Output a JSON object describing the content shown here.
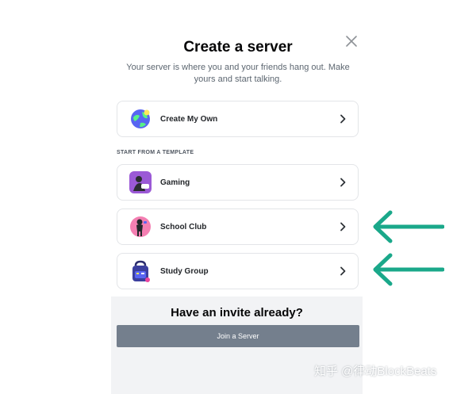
{
  "modal": {
    "title": "Create a server",
    "subtitle": "Your server is where you and your friends hang out. Make yours and start talking."
  },
  "options": {
    "create_own": {
      "label": "Create My Own",
      "icon": "globe-icon"
    },
    "section_header": "START FROM A TEMPLATE",
    "templates": [
      {
        "label": "Gaming",
        "icon": "gaming-icon"
      },
      {
        "label": "School Club",
        "icon": "school-club-icon"
      },
      {
        "label": "Study Group",
        "icon": "study-group-icon"
      }
    ]
  },
  "footer": {
    "title": "Have an invite already?",
    "join_label": "Join a Server"
  },
  "watermark": "知乎 @律动BlockBeats",
  "colors": {
    "annotation_arrow": "#1aa88a",
    "join_button": "#747f8d",
    "footer_bg": "#f2f3f5"
  }
}
